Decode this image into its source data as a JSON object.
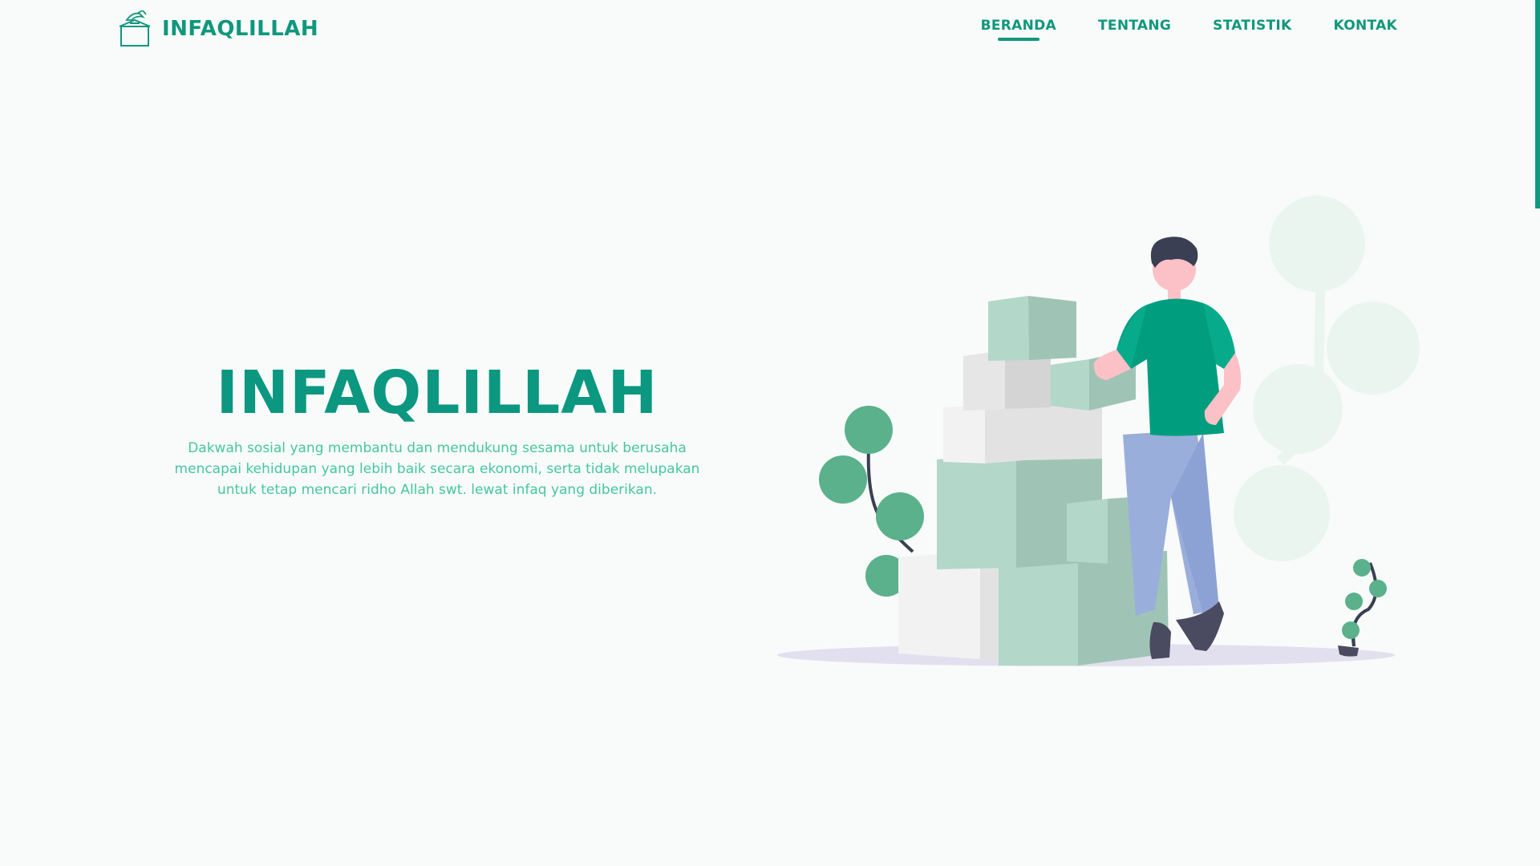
{
  "brand": {
    "name": "INFAQLILLAH",
    "logo_icon": "donation-box-icon"
  },
  "nav": {
    "items": [
      {
        "label": "BERANDA",
        "active": true
      },
      {
        "label": "TENTANG",
        "active": false
      },
      {
        "label": "STATISTIK",
        "active": false
      },
      {
        "label": "KONTAK",
        "active": false
      }
    ]
  },
  "hero": {
    "title": "INFAQLILLAH",
    "description": "Dakwah sosial yang membantu dan mendukung sesama untuk berusaha mencapai kehidupan yang lebih baik secara ekonomi, serta tidak melupakan untuk tetap mencari ridho Allah swt. lewat infaq yang diberikan.",
    "illustration_icon": "man-with-boxes-illustration"
  },
  "colors": {
    "primary": "#10977c",
    "primary_light": "#46c69e",
    "background": "#f8fbfa",
    "box_green": "#b3d7c8",
    "shirt": "#009e7f",
    "jeans": "#9aaedb"
  }
}
